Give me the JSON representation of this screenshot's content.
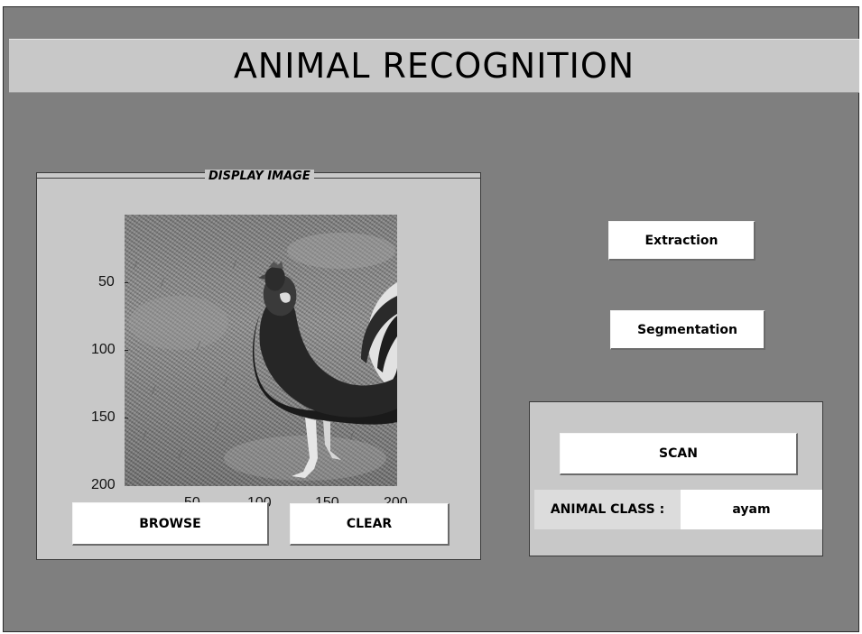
{
  "app": {
    "title": "ANIMAL RECOGNITION"
  },
  "display_panel": {
    "legend": "DISPLAY IMAGE",
    "axes": {
      "y_ticks": [
        "50",
        "100",
        "150",
        "200"
      ],
      "x_ticks": [
        "50",
        "100",
        "150",
        "200"
      ]
    },
    "image_icon": "rooster-photo-grayscale"
  },
  "buttons": {
    "browse": "BROWSE",
    "clear": "CLEAR",
    "extraction": "Extraction",
    "segmentation": "Segmentation",
    "scan": "SCAN"
  },
  "result": {
    "label": "ANIMAL CLASS :",
    "value": "ayam"
  },
  "colors": {
    "background": "#7f7f7f",
    "panel": "#c8c8c8",
    "button": "#ffffff"
  }
}
